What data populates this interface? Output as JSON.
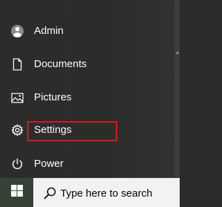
{
  "start_menu": {
    "items": [
      {
        "id": "admin",
        "label": "Admin",
        "icon": "user-avatar-icon"
      },
      {
        "id": "documents",
        "label": "Documents",
        "icon": "document-icon"
      },
      {
        "id": "pictures",
        "label": "Pictures",
        "icon": "picture-icon"
      },
      {
        "id": "settings",
        "label": "Settings",
        "icon": "gear-icon",
        "highlighted": true
      },
      {
        "id": "power",
        "label": "Power",
        "icon": "power-icon"
      }
    ],
    "highlight_color": "#d51c1c"
  },
  "taskbar": {
    "start_icon": "windows-logo-icon",
    "search": {
      "icon": "search-icon",
      "placeholder": "Type here to search"
    }
  },
  "colors": {
    "menu_background": "#2b2b2b",
    "text": "#ffffff",
    "start_button": "#354235",
    "search_background": "#f2f2f2"
  }
}
